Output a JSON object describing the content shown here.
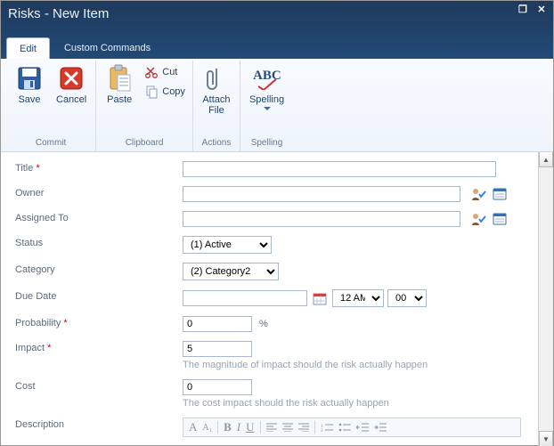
{
  "window": {
    "title": "Risks - New Item"
  },
  "tabs": {
    "edit": "Edit",
    "custom": "Custom Commands"
  },
  "ribbon": {
    "commit": {
      "label": "Commit",
      "save": "Save",
      "cancel": "Cancel"
    },
    "clipboard": {
      "label": "Clipboard",
      "paste": "Paste",
      "cut": "Cut",
      "copy": "Copy"
    },
    "actions": {
      "label": "Actions",
      "attach": "Attach\nFile"
    },
    "spelling": {
      "label": "Spelling",
      "spelling": "Spelling"
    }
  },
  "form": {
    "title": {
      "label": "Title",
      "required": "*",
      "value": ""
    },
    "owner": {
      "label": "Owner",
      "value": ""
    },
    "assigned": {
      "label": "Assigned To",
      "value": ""
    },
    "status": {
      "label": "Status",
      "value": "(1) Active"
    },
    "category": {
      "label": "Category",
      "value": "(2) Category2"
    },
    "duedate": {
      "label": "Due Date",
      "date_value": "",
      "hour_value": "12 AM",
      "minute_value": "00"
    },
    "probability": {
      "label": "Probability",
      "required": "*",
      "value": "0",
      "suffix": "%"
    },
    "impact": {
      "label": "Impact",
      "required": "*",
      "value": "5",
      "hint": "The magnitude of impact should the risk actually happen"
    },
    "cost": {
      "label": "Cost",
      "value": "0",
      "hint": "The cost impact should the risk actually happen"
    },
    "description": {
      "label": "Description"
    }
  },
  "rte_labels": {
    "a1": "A",
    "a2": "A₁",
    "b": "B",
    "i": "I",
    "u": "U"
  }
}
